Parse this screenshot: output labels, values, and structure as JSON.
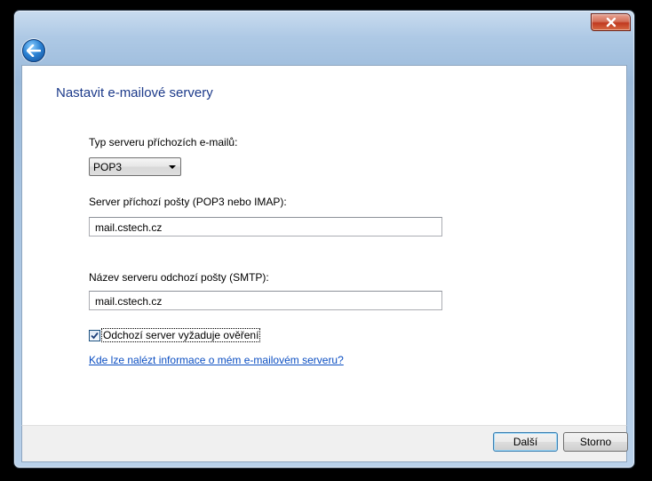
{
  "window": {
    "close_icon": "close-x-icon",
    "back_icon": "back-arrow-icon"
  },
  "page": {
    "title": "Nastavit e-mailové servery"
  },
  "form": {
    "incoming_type_label": "Typ serveru příchozích e-mailů:",
    "incoming_type_value": "POP3",
    "incoming_server_label": "Server příchozí pošty (POP3 nebo IMAP):",
    "incoming_server_value": "mail.cstech.cz",
    "outgoing_server_label": "Název serveru odchozí pošty (SMTP):",
    "outgoing_server_value": "mail.cstech.cz",
    "auth_required_label": "Odchozí server vyžaduje ověření",
    "auth_required_checked": true,
    "help_link": "Kde lze nalézt informace o mém e-mailovém serveru?"
  },
  "footer": {
    "next_label": "Další",
    "cancel_label": "Storno"
  },
  "colors": {
    "title": "#1c3a8a",
    "link": "#0b4ec2",
    "close": "#c0391f"
  }
}
